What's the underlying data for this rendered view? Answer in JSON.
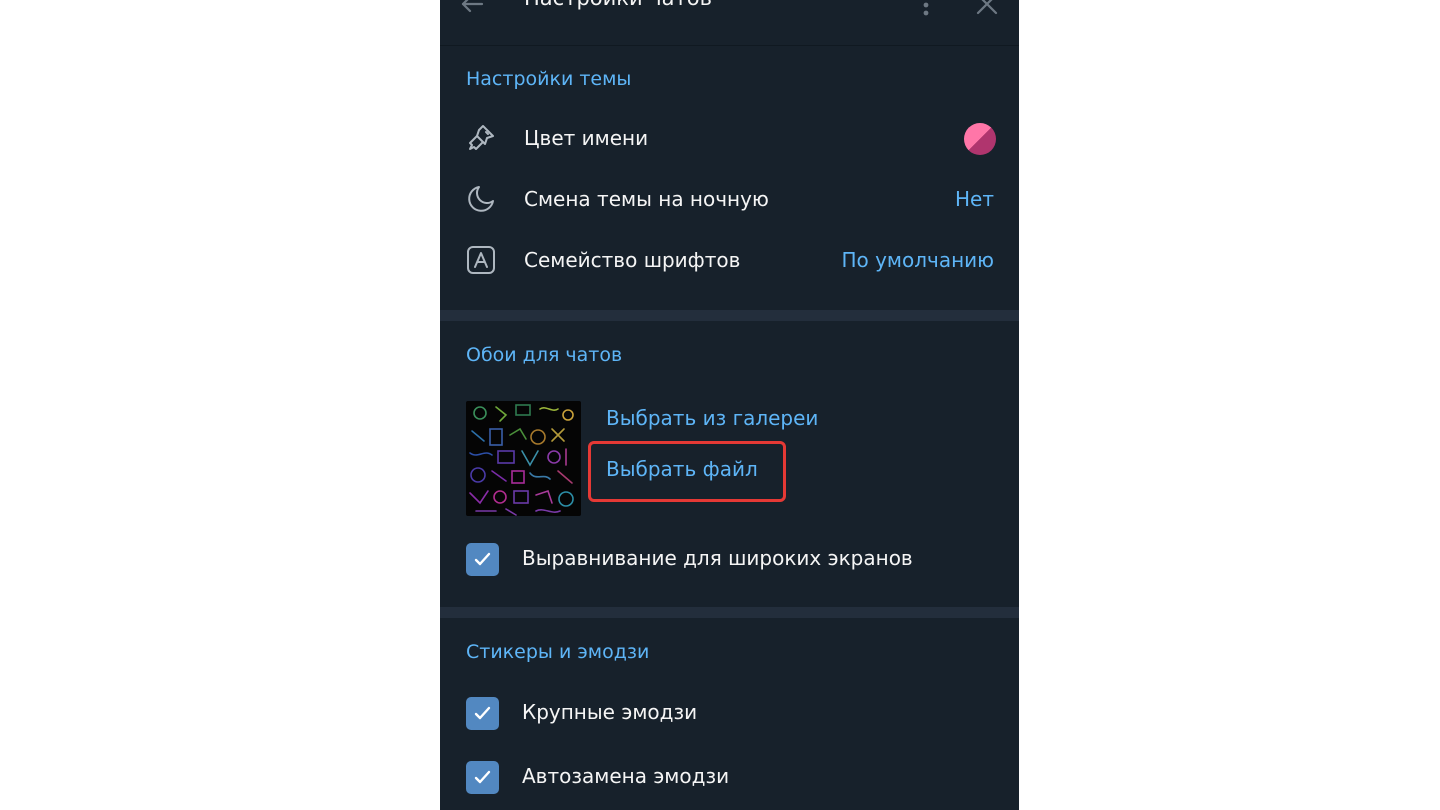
{
  "header": {
    "title": "Настройки чатов",
    "back_icon": "arrow-left-icon",
    "menu_icon": "more-vertical-icon",
    "close_icon": "close-icon"
  },
  "theme_section": {
    "title": "Настройки темы",
    "items": [
      {
        "label": "Цвет имени",
        "icon": "brush-icon",
        "value": ""
      },
      {
        "label": "Смена темы на ночную",
        "icon": "moon-icon",
        "value": "Нет"
      },
      {
        "label": "Семейство шрифтов",
        "icon": "font-icon",
        "value": "По умолчанию"
      }
    ]
  },
  "wallpaper_section": {
    "title": "Обои для чатов",
    "choose_gallery": "Выбрать из галереи",
    "choose_file": "Выбрать файл",
    "wide_screen_label": "Выравнивание для широких экранов",
    "wide_screen_checked": true
  },
  "stickers_section": {
    "title": "Стикеры и эмодзи",
    "large_emoji_label": "Крупные эмодзи",
    "large_emoji_checked": true,
    "replace_emoji_label": "Автозамена эмодзи",
    "replace_emoji_checked": true
  },
  "colors": {
    "panel_bg": "#17212b",
    "accent": "#5eb5f7",
    "checkbox": "#5288c1",
    "highlight": "#e53935"
  }
}
